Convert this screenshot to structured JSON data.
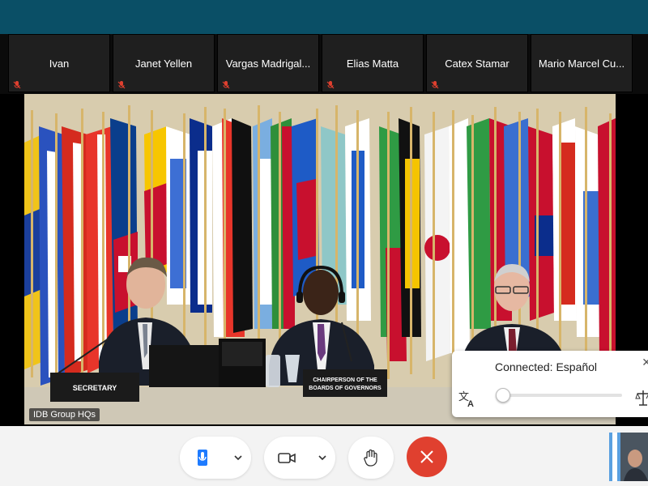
{
  "participants": [
    {
      "name": "Ivan",
      "muted": true
    },
    {
      "name": "Janet Yellen",
      "muted": true
    },
    {
      "name": "Vargas Madrigal...",
      "muted": true
    },
    {
      "name": "Elias Matta",
      "muted": true
    },
    {
      "name": "Catex Stamar",
      "muted": true
    },
    {
      "name": "Mario Marcel Cu...",
      "muted": false
    }
  ],
  "video": {
    "room_label": "IDB Group HQs",
    "placards": {
      "left": "SECRETARY",
      "center_line1": "CHAIRPERSON OF THE",
      "center_line2": "BOARDS OF GOVERNORS"
    }
  },
  "interpretation": {
    "status": "Connected: Español",
    "volume_level": 0.03
  },
  "controls": {
    "mute_icon": "microphone-icon",
    "video_icon": "camera-icon",
    "reaction_icon": "raise-hand-icon",
    "end_icon": "end-call-icon"
  },
  "colors": {
    "topbar": "#0a4f66",
    "end_call": "#e0402f",
    "mute_accent": "#1e7bff",
    "muted_icon": "#e0402f"
  }
}
